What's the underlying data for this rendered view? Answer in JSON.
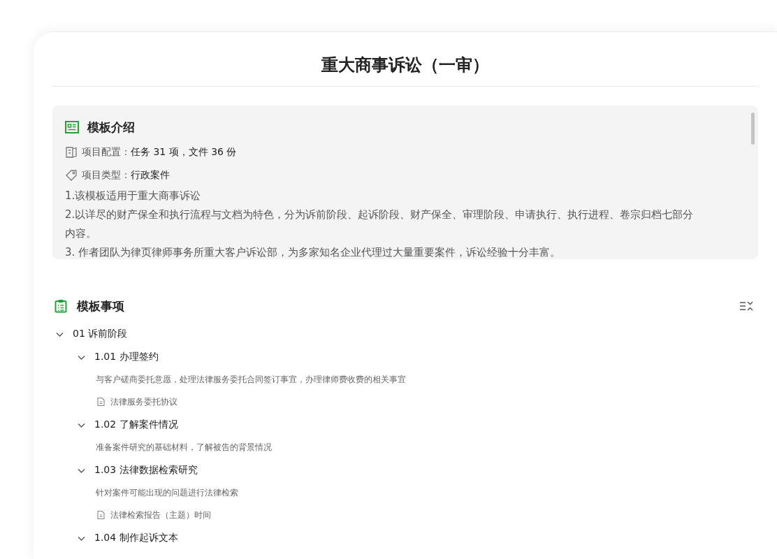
{
  "title": "重大商事诉讼（一审）",
  "intro": {
    "heading": "模板介绍",
    "config": {
      "label": "项目配置：",
      "value": "任务 31 项，文件 36 份"
    },
    "type": {
      "label": "项目类型：",
      "value": "行政案件"
    },
    "paragraphs": [
      "1.该模板适用于重大商事诉讼",
      "2.以详尽的财产保全和执行流程与文档为特色，分为诉前阶段、起诉阶段、财产保全、审理阶段、申请执行、执行进程、卷宗归档七部分内容。",
      "3. 作者团队为律页律师事务所重大客户诉讼部，为多家知名企业代理过大量重要案件，诉讼经验十分丰富。"
    ]
  },
  "items_section": {
    "heading": "模板事项",
    "tree": [
      {
        "label": "01 诉前阶段",
        "expanded": true,
        "children": [
          {
            "label": "1.01 办理签约",
            "expanded": true,
            "description": "与客户磋商委托意愿，处理法律服务委托合同签订事宜，办理律师费收费的相关事宜",
            "files": [
              "法律服务委托协议"
            ]
          },
          {
            "label": "1.02 了解案件情况",
            "expanded": true,
            "description": "准备案件研究的基础材料，了解被告的背景情况"
          },
          {
            "label": "1.03  法律数据检索研究",
            "expanded": true,
            "description": "针对案件可能出现的问题进行法律检索",
            "files": [
              "法律检索报告（主题）时间"
            ]
          },
          {
            "label": "1.04  制作起诉文本",
            "expanded": true
          }
        ]
      }
    ]
  }
}
